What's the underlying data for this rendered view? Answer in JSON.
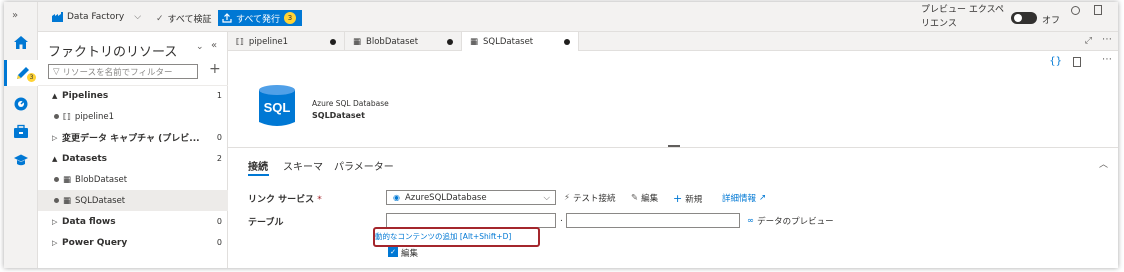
{
  "toolbar": {
    "collapse_glyph": "»",
    "data_factory": "Data Factory",
    "validate_all": "すべて検証",
    "publish_all": "すべて発行",
    "publish_count": "3",
    "preview_experience": "プレビュー エクスペリエンス",
    "preview_off": "オフ"
  },
  "rail": {
    "author_badge": "3"
  },
  "resources": {
    "title": "ファクトリのリソース",
    "filter_placeholder": "リソースを名前でフィルター",
    "sections": [
      {
        "label": "Pipelines",
        "count": "1"
      },
      {
        "label": "変更データ キャプチャ (プレビ...",
        "count": "0"
      },
      {
        "label": "Datasets",
        "count": "2"
      },
      {
        "label": "Data flows",
        "count": "0"
      },
      {
        "label": "Power Query",
        "count": "0"
      }
    ],
    "items": [
      {
        "label": "pipeline1"
      },
      {
        "label": "BlobDataset"
      },
      {
        "label": "SQLDataset"
      }
    ]
  },
  "tabs": [
    {
      "label": "pipeline1"
    },
    {
      "label": "BlobDataset"
    },
    {
      "label": "SQLDataset"
    }
  ],
  "dataset": {
    "icon_text": "SQL",
    "type": "Azure SQL Database",
    "name": "SQLDataset"
  },
  "subtabs": [
    "接続",
    "スキーマ",
    "パラメーター"
  ],
  "connection": {
    "linked_service_label": "リンク サービス",
    "required_mark": "*",
    "linked_service_value": "AzureSQLDatabase",
    "test_connection": "テスト接続",
    "edit": "編集",
    "new": "新規",
    "details": "詳細情報",
    "table_label": "テーブル",
    "separator": ".",
    "preview_data": "データのプレビュー",
    "dynamic_content": "動的なコンテンツの追加 [Alt+Shift+D]",
    "edit_checkbox": "編集"
  },
  "colors": {
    "accent": "#0078d4",
    "highlight_border": "#a4262c",
    "badge": "#ffd335"
  }
}
